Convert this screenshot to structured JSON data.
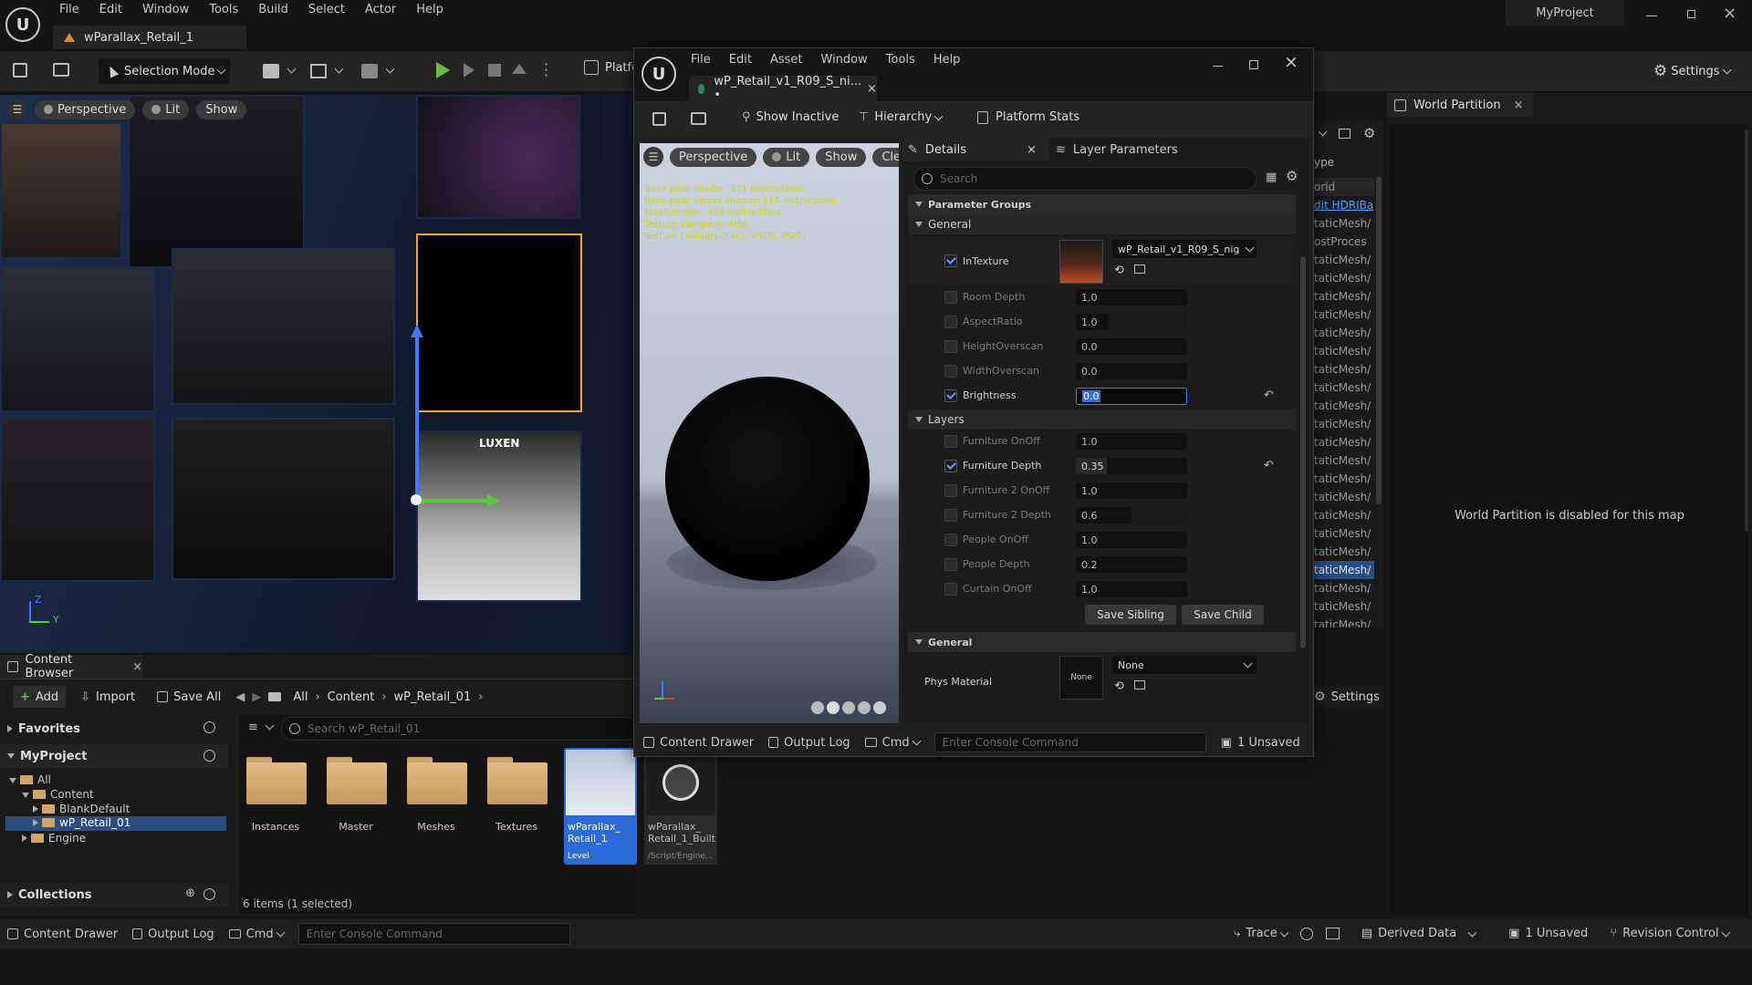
{
  "app": {
    "project_name": "MyProject",
    "menu": [
      "File",
      "Edit",
      "Window",
      "Tools",
      "Build",
      "Select",
      "Actor",
      "Help"
    ],
    "level_tab": "wParallax_Retail_1"
  },
  "toolbar": {
    "selection_mode": "Selection Mode",
    "platforms": "Platfo",
    "settings": "Settings"
  },
  "viewport": {
    "perspective": "Perspective",
    "lit": "Lit",
    "show": "Show",
    "sign_text": "LUXEN",
    "axis_z": "Z",
    "axis_y": "Y"
  },
  "material_editor": {
    "menu": [
      "File",
      "Edit",
      "Asset",
      "Window",
      "Tools",
      "Help"
    ],
    "tab_title": "wP_Retail_v1_R09_S_ni... •",
    "toolbar": {
      "show_inactive": "Show Inactive",
      "hierarchy": "Hierarchy",
      "platform_stats": "Platform Stats"
    },
    "preview": {
      "perspective": "Perspective",
      "lit": "Lit",
      "show": "Show",
      "clear": "Clear",
      "stats": [
        "Base pass shader: 371 instructions",
        "Base pass vertex shader: 137 instructions",
        "MaxSampler: 420 instructions",
        "Texture samplers: 4/16",
        "Texture Lookups (Est.): VS(3), PS(5)"
      ]
    },
    "details": {
      "tab_details": "Details",
      "tab_layer_params": "Layer Parameters",
      "search_placeholder": "Search",
      "section_param_groups": "Parameter Groups",
      "section_general": "General",
      "intexture_label": "InTexture",
      "intexture_value": "wP_Retail_v1_R09_S_nig",
      "params_general": [
        {
          "label": "Room Depth",
          "value": "1.0",
          "enabled": false
        },
        {
          "label": "AspectRatio",
          "value": "1.0",
          "enabled": false
        },
        {
          "label": "HeightOverscan",
          "value": "0.0",
          "enabled": false
        },
        {
          "label": "WidthOverscan",
          "value": "0.0",
          "enabled": false
        }
      ],
      "brightness_label": "Brightness",
      "brightness_value": "0.0",
      "section_layers": "Layers",
      "params_layers": [
        {
          "label": "Furniture OnOff",
          "value": "1.0",
          "enabled": false
        },
        {
          "label": "Furniture  Depth",
          "value": "0.35",
          "enabled": true
        },
        {
          "label": "Furniture 2 OnOff",
          "value": "1.0",
          "enabled": false
        },
        {
          "label": "Furniture 2 Depth",
          "value": "0.6",
          "enabled": false
        },
        {
          "label": "People OnOff",
          "value": "1.0",
          "enabled": false
        },
        {
          "label": "People Depth",
          "value": "0.2",
          "enabled": false
        },
        {
          "label": "Curtain OnOff",
          "value": "1.0",
          "enabled": false
        }
      ],
      "save_sibling": "Save Sibling",
      "save_child": "Save Child",
      "section_general_2": "General",
      "phys_material_label": "Phys Material",
      "phys_material_thumb": "None",
      "phys_material_value": "None"
    },
    "bottom": {
      "content_drawer": "Content Drawer",
      "output_log": "Output Log",
      "cmd": "Cmd",
      "console_placeholder": "Enter Console Command",
      "unsaved": "1 Unsaved"
    }
  },
  "outliner": {
    "header": "ype",
    "rows": [
      "orld",
      "dit HDRIBa",
      "taticMesh/",
      "ostProces",
      "taticMesh/",
      "taticMesh/",
      "taticMesh/",
      "taticMesh/",
      "taticMesh/",
      "taticMesh/",
      "taticMesh/",
      "taticMesh/",
      "taticMesh/",
      "taticMesh/",
      "taticMesh/",
      "taticMesh/",
      "taticMesh/",
      "taticMesh/",
      "taticMesh/",
      "taticMesh/",
      "taticMesh/",
      "taticMesh/",
      "taticMesh/",
      "taticMesh/",
      "taticMesh/"
    ],
    "settings": "Settings"
  },
  "world_partition": {
    "tab": "World Partition",
    "message": "World Partition is disabled for this map"
  },
  "content_browser": {
    "tab": "Content Browser",
    "add": "Add",
    "import": "Import",
    "save_all": "Save All",
    "path": [
      "All",
      "Content",
      "wP_Retail_01"
    ],
    "favorites": "Favorites",
    "project": "MyProject",
    "tree": [
      "All",
      "Content",
      "BlankDefault",
      "wP_Retail_01",
      "Engine"
    ],
    "search_placeholder": "Search wP_Retail_01",
    "assets": [
      {
        "name": "Instances"
      },
      {
        "name": "Master"
      },
      {
        "name": "Meshes"
      },
      {
        "name": "Textures"
      }
    ],
    "level_asset": {
      "name": "wParallax_\nRetail_1",
      "type": "Level"
    },
    "built_asset": {
      "name": "wParallax_\nRetail_1_Built",
      "type": "/Script/Engine..."
    },
    "collections": "Collections",
    "status": "6 items (1 selected)"
  },
  "statusbar": {
    "content_drawer": "Content Drawer",
    "output_log": "Output Log",
    "cmd": "Cmd",
    "console_placeholder": "Enter Console Command",
    "trace": "Trace",
    "derived_data": "Derived Data",
    "unsaved": "1 Unsaved",
    "revision_control": "Revision Control"
  }
}
